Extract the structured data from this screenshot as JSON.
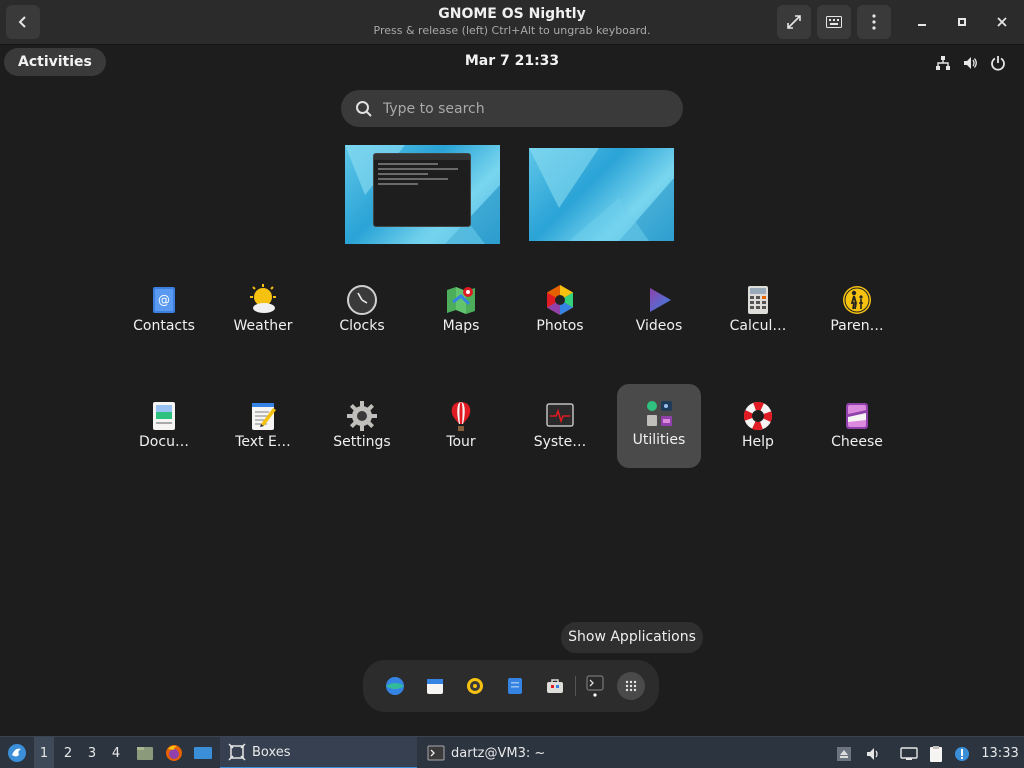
{
  "titlebar": {
    "title": "GNOME OS Nightly",
    "subtitle": "Press & release (left) Ctrl+Alt to ungrab keyboard."
  },
  "panel": {
    "activities": "Activities",
    "clock": "Mar 7  21:33"
  },
  "search": {
    "placeholder": "Type to search"
  },
  "apps_row1": [
    {
      "label": "Contacts",
      "icon": "contacts-icon"
    },
    {
      "label": "Weather",
      "icon": "weather-icon"
    },
    {
      "label": "Clocks",
      "icon": "clocks-icon"
    },
    {
      "label": "Maps",
      "icon": "maps-icon"
    },
    {
      "label": "Photos",
      "icon": "photos-icon"
    },
    {
      "label": "Videos",
      "icon": "videos-icon"
    },
    {
      "label": "Calcul…",
      "icon": "calculator-icon"
    },
    {
      "label": "Paren…",
      "icon": "parental-controls-icon"
    }
  ],
  "apps_row2": [
    {
      "label": "Docu…",
      "icon": "document-viewer-icon"
    },
    {
      "label": "Text E…",
      "icon": "text-editor-icon"
    },
    {
      "label": "Settings",
      "icon": "settings-gear-icon"
    },
    {
      "label": "Tour",
      "icon": "tour-balloon-icon"
    },
    {
      "label": "Syste…",
      "icon": "system-monitor-icon"
    },
    {
      "label": "Utilities",
      "icon": "utilities-folder-icon"
    },
    {
      "label": "Help",
      "icon": "help-lifebuoy-icon"
    },
    {
      "label": "Cheese",
      "icon": "cheese-icon"
    }
  ],
  "tooltip": "Show Applications",
  "taskbar": {
    "workspaces": [
      "1",
      "2",
      "3",
      "4"
    ],
    "task_boxes": "Boxes",
    "task_terminal": "dartz@VM3: ~",
    "clock": "13:33"
  },
  "colors": {
    "accent": "#3b8fd9",
    "panel_bg": "#1d1d1d",
    "highlight": "#4a4a4a"
  }
}
